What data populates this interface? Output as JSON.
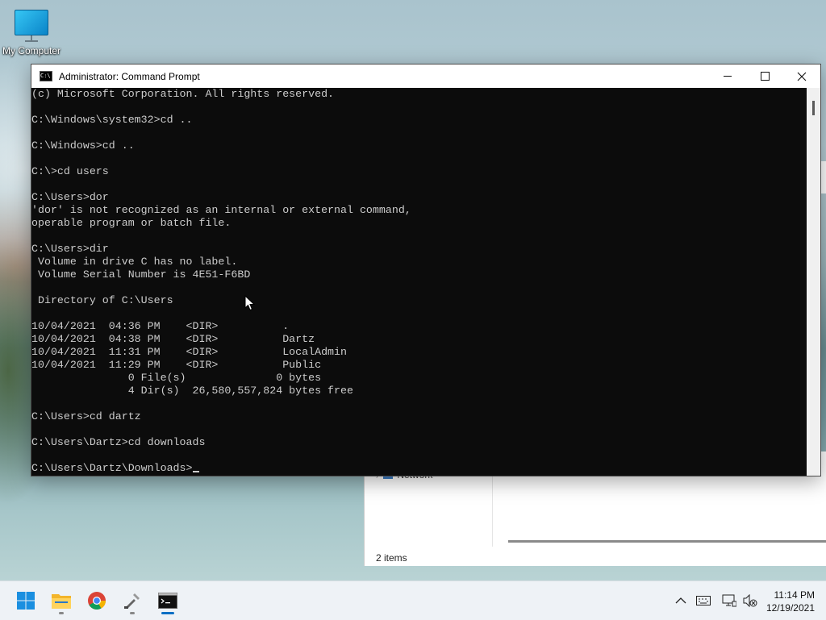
{
  "desktop": {
    "icon_label": "My Computer"
  },
  "explorer": {
    "nav_item": "Network",
    "status": "2 items"
  },
  "cmd": {
    "title": "Administrator: Command Prompt",
    "lines": [
      "(c) Microsoft Corporation. All rights reserved.",
      "",
      "C:\\Windows\\system32>cd ..",
      "",
      "C:\\Windows>cd ..",
      "",
      "C:\\>cd users",
      "",
      "C:\\Users>dor",
      "'dor' is not recognized as an internal or external command,",
      "operable program or batch file.",
      "",
      "C:\\Users>dir",
      " Volume in drive C has no label.",
      " Volume Serial Number is 4E51-F6BD",
      "",
      " Directory of C:\\Users",
      "",
      "10/04/2021  04:36 PM    <DIR>          .",
      "10/04/2021  04:38 PM    <DIR>          Dartz",
      "10/04/2021  11:31 PM    <DIR>          LocalAdmin",
      "10/04/2021  11:29 PM    <DIR>          Public",
      "               0 File(s)              0 bytes",
      "               4 Dir(s)  26,580,557,824 bytes free",
      "",
      "C:\\Users>cd dartz",
      "",
      "C:\\Users\\Dartz>cd downloads",
      "",
      "C:\\Users\\Dartz\\Downloads>"
    ]
  },
  "taskbar": {
    "apps": [
      "start-icon",
      "file-explorer-icon",
      "chrome-icon",
      "tool-icon",
      "command-prompt-icon"
    ],
    "time": "11:14 PM",
    "date": "12/19/2021"
  },
  "colors": {
    "console_bg": "#0c0c0c",
    "console_fg": "#cccccc",
    "accent": "#0a6fc4"
  }
}
